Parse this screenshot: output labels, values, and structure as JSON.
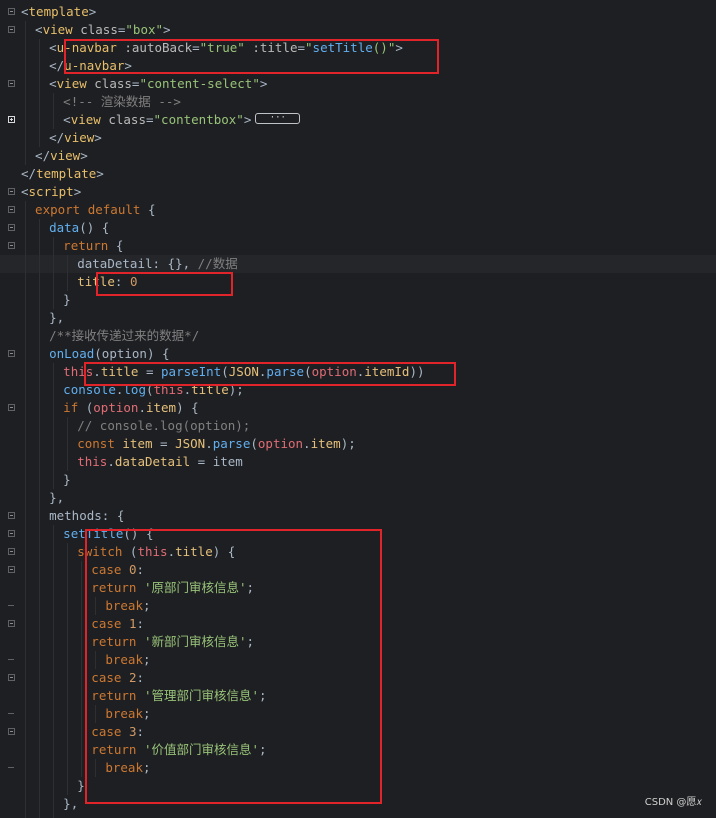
{
  "lines": [
    {
      "fold": "open",
      "indent": 0,
      "tokens": [
        [
          "t-brk",
          "<"
        ],
        [
          "t-tag",
          "template"
        ],
        [
          "t-brk",
          ">"
        ]
      ]
    },
    {
      "fold": "open",
      "indent": 2,
      "tokens": [
        [
          "t-brk",
          "<"
        ],
        [
          "t-tag",
          "view "
        ],
        [
          "t-attr",
          "class"
        ],
        [
          "t-plain",
          "="
        ],
        [
          "t-str2",
          "\"box\""
        ],
        [
          "t-brk",
          ">"
        ]
      ]
    },
    {
      "fold": "none",
      "indent": 4,
      "tokens": [
        [
          "t-brk",
          "<"
        ],
        [
          "t-tag",
          "u-navbar "
        ],
        [
          "t-attr",
          ":autoBack"
        ],
        [
          "t-plain",
          "="
        ],
        [
          "t-str2",
          "\"true\""
        ],
        [
          "t-plain",
          " "
        ],
        [
          "t-attr",
          ":title"
        ],
        [
          "t-plain",
          "="
        ],
        [
          "t-str2",
          "\""
        ],
        [
          "t-fn",
          "setTitle"
        ],
        [
          "t-str2",
          "()\""
        ],
        [
          "t-brk",
          ">"
        ]
      ]
    },
    {
      "fold": "none",
      "indent": 4,
      "tokens": [
        [
          "t-brk",
          "</"
        ],
        [
          "t-tag",
          "u-navbar"
        ],
        [
          "t-brk",
          ">"
        ]
      ]
    },
    {
      "fold": "open",
      "indent": 4,
      "tokens": [
        [
          "t-brk",
          "<"
        ],
        [
          "t-tag",
          "view "
        ],
        [
          "t-attr",
          "class"
        ],
        [
          "t-plain",
          "="
        ],
        [
          "t-str2",
          "\"content-select\""
        ],
        [
          "t-brk",
          ">"
        ]
      ]
    },
    {
      "fold": "none",
      "indent": 6,
      "tokens": [
        [
          "t-cm",
          "<!-- 渲染数据 -->"
        ]
      ]
    },
    {
      "fold": "plus",
      "indent": 6,
      "tokens": [
        [
          "t-brk",
          "<"
        ],
        [
          "t-tag",
          "view "
        ],
        [
          "t-attr",
          "class"
        ],
        [
          "t-plain",
          "="
        ],
        [
          "t-str2",
          "\"contentbox\""
        ],
        [
          "t-brk",
          ">"
        ]
      ],
      "collapsed": "···"
    },
    {
      "fold": "none",
      "indent": 4,
      "tokens": [
        [
          "t-brk",
          "</"
        ],
        [
          "t-tag",
          "view"
        ],
        [
          "t-brk",
          ">"
        ]
      ]
    },
    {
      "fold": "none",
      "indent": 2,
      "tokens": [
        [
          "t-brk",
          "</"
        ],
        [
          "t-tag",
          "view"
        ],
        [
          "t-brk",
          ">"
        ]
      ]
    },
    {
      "fold": "none",
      "indent": 0,
      "tokens": [
        [
          "t-brk",
          "</"
        ],
        [
          "t-tag",
          "template"
        ],
        [
          "t-brk",
          ">"
        ]
      ]
    },
    {
      "fold": "open",
      "indent": 0,
      "tokens": [
        [
          "t-brk",
          "<"
        ],
        [
          "t-tag",
          "script"
        ],
        [
          "t-brk",
          ">"
        ]
      ]
    },
    {
      "fold": "open",
      "indent": 2,
      "tokens": [
        [
          "t-kw",
          "export default "
        ],
        [
          "t-plain",
          "{"
        ]
      ]
    },
    {
      "fold": "open",
      "indent": 4,
      "tokens": [
        [
          "t-fn",
          "data"
        ],
        [
          "t-plain",
          "() {"
        ]
      ]
    },
    {
      "fold": "open",
      "indent": 6,
      "tokens": [
        [
          "t-kw",
          "return "
        ],
        [
          "t-plain",
          "{"
        ]
      ]
    },
    {
      "fold": "none",
      "indent": 8,
      "hl": true,
      "tokens": [
        [
          "t-plain",
          "dataDetail: {}, "
        ],
        [
          "t-cm",
          "//数据"
        ]
      ]
    },
    {
      "fold": "none",
      "indent": 8,
      "tokens": [
        [
          "t-var",
          "title"
        ],
        [
          "t-plain",
          ": "
        ],
        [
          "t-num",
          "0"
        ]
      ]
    },
    {
      "fold": "none",
      "indent": 6,
      "tokens": [
        [
          "t-plain",
          "}"
        ]
      ]
    },
    {
      "fold": "none",
      "indent": 4,
      "tokens": [
        [
          "t-plain",
          "},"
        ]
      ]
    },
    {
      "fold": "none",
      "indent": 4,
      "tokens": [
        [
          "t-cm",
          "/**接收传递过来的数据*/"
        ]
      ]
    },
    {
      "fold": "open",
      "indent": 4,
      "tokens": [
        [
          "t-fn",
          "onLoad"
        ],
        [
          "t-plain",
          "(option) {"
        ]
      ]
    },
    {
      "fold": "none",
      "indent": 6,
      "tokens": [
        [
          "t-this",
          "this"
        ],
        [
          "t-plain",
          "."
        ],
        [
          "t-var",
          "title"
        ],
        [
          "t-plain",
          " = "
        ],
        [
          "t-fn",
          "parseInt"
        ],
        [
          "t-plain",
          "("
        ],
        [
          "t-var",
          "JSON"
        ],
        [
          "t-plain",
          "."
        ],
        [
          "t-fn",
          "parse"
        ],
        [
          "t-plain",
          "("
        ],
        [
          "t-this",
          "option"
        ],
        [
          "t-plain",
          "."
        ],
        [
          "t-var",
          "itemId"
        ],
        [
          "t-plain",
          "))"
        ]
      ]
    },
    {
      "fold": "none",
      "indent": 6,
      "tokens": [
        [
          "t-fn",
          "console"
        ],
        [
          "t-plain",
          "."
        ],
        [
          "t-fn",
          "log"
        ],
        [
          "t-plain",
          "("
        ],
        [
          "t-this",
          "this"
        ],
        [
          "t-plain",
          "."
        ],
        [
          "t-var",
          "title"
        ],
        [
          "t-plain",
          ");"
        ]
      ]
    },
    {
      "fold": "open",
      "indent": 6,
      "tokens": [
        [
          "t-kw",
          "if "
        ],
        [
          "t-plain",
          "("
        ],
        [
          "t-this",
          "option"
        ],
        [
          "t-plain",
          "."
        ],
        [
          "t-var",
          "item"
        ],
        [
          "t-plain",
          ") {"
        ]
      ]
    },
    {
      "fold": "none",
      "indent": 8,
      "tokens": [
        [
          "t-cm",
          "// console.log(option);"
        ]
      ]
    },
    {
      "fold": "none",
      "indent": 8,
      "tokens": [
        [
          "t-kw",
          "const "
        ],
        [
          "t-var",
          "item"
        ],
        [
          "t-plain",
          " = "
        ],
        [
          "t-var",
          "JSON"
        ],
        [
          "t-plain",
          "."
        ],
        [
          "t-fn",
          "parse"
        ],
        [
          "t-plain",
          "("
        ],
        [
          "t-this",
          "option"
        ],
        [
          "t-plain",
          "."
        ],
        [
          "t-var",
          "item"
        ],
        [
          "t-plain",
          ");"
        ]
      ]
    },
    {
      "fold": "none",
      "indent": 8,
      "tokens": [
        [
          "t-this",
          "this"
        ],
        [
          "t-plain",
          "."
        ],
        [
          "t-var",
          "dataDetail"
        ],
        [
          "t-plain",
          " = item"
        ]
      ]
    },
    {
      "fold": "none",
      "indent": 6,
      "tokens": [
        [
          "t-plain",
          "}"
        ]
      ]
    },
    {
      "fold": "none",
      "indent": 4,
      "tokens": [
        [
          "t-plain",
          "},"
        ]
      ]
    },
    {
      "fold": "open",
      "indent": 4,
      "tokens": [
        [
          "t-plain",
          "methods: {"
        ]
      ]
    },
    {
      "fold": "open",
      "indent": 6,
      "tokens": [
        [
          "t-fn",
          "setTitle"
        ],
        [
          "t-plain",
          "() {"
        ]
      ]
    },
    {
      "fold": "open",
      "indent": 8,
      "tokens": [
        [
          "t-kw",
          "switch "
        ],
        [
          "t-plain",
          "("
        ],
        [
          "t-this",
          "this"
        ],
        [
          "t-plain",
          "."
        ],
        [
          "t-var",
          "title"
        ],
        [
          "t-plain",
          ") {"
        ]
      ]
    },
    {
      "fold": "open",
      "indent": 10,
      "tokens": [
        [
          "t-kw",
          "case "
        ],
        [
          "t-num",
          "0"
        ],
        [
          "t-plain",
          ":"
        ]
      ]
    },
    {
      "fold": "none",
      "indent": 10,
      "tokens": [
        [
          "t-kw",
          "return "
        ],
        [
          "t-str2",
          "'原部门审核信息'"
        ],
        [
          "t-plain",
          ";"
        ]
      ]
    },
    {
      "fold": "end",
      "indent": 12,
      "tokens": [
        [
          "t-kw",
          "break"
        ],
        [
          "t-plain",
          ";"
        ]
      ]
    },
    {
      "fold": "open",
      "indent": 10,
      "tokens": [
        [
          "t-kw",
          "case "
        ],
        [
          "t-num",
          "1"
        ],
        [
          "t-plain",
          ":"
        ]
      ]
    },
    {
      "fold": "none",
      "indent": 10,
      "tokens": [
        [
          "t-kw",
          "return "
        ],
        [
          "t-str2",
          "'新部门审核信息'"
        ],
        [
          "t-plain",
          ";"
        ]
      ]
    },
    {
      "fold": "end",
      "indent": 12,
      "tokens": [
        [
          "t-kw",
          "break"
        ],
        [
          "t-plain",
          ";"
        ]
      ]
    },
    {
      "fold": "open",
      "indent": 10,
      "tokens": [
        [
          "t-kw",
          "case "
        ],
        [
          "t-num",
          "2"
        ],
        [
          "t-plain",
          ":"
        ]
      ]
    },
    {
      "fold": "none",
      "indent": 10,
      "tokens": [
        [
          "t-kw",
          "return "
        ],
        [
          "t-str2",
          "'管理部门审核信息'"
        ],
        [
          "t-plain",
          ";"
        ]
      ]
    },
    {
      "fold": "end",
      "indent": 12,
      "tokens": [
        [
          "t-kw",
          "break"
        ],
        [
          "t-plain",
          ";"
        ]
      ]
    },
    {
      "fold": "open",
      "indent": 10,
      "tokens": [
        [
          "t-kw",
          "case "
        ],
        [
          "t-num",
          "3"
        ],
        [
          "t-plain",
          ":"
        ]
      ]
    },
    {
      "fold": "none",
      "indent": 10,
      "tokens": [
        [
          "t-kw",
          "return "
        ],
        [
          "t-str2",
          "'价值部门审核信息'"
        ],
        [
          "t-plain",
          ";"
        ]
      ]
    },
    {
      "fold": "end",
      "indent": 12,
      "tokens": [
        [
          "t-kw",
          "break"
        ],
        [
          "t-plain",
          ";"
        ]
      ]
    },
    {
      "fold": "none",
      "indent": 8,
      "tokens": [
        [
          "t-plain",
          "}"
        ]
      ]
    },
    {
      "fold": "none",
      "indent": 6,
      "tokens": [
        [
          "t-plain",
          "},"
        ]
      ]
    },
    {
      "fold": "none",
      "indent": 6,
      "tokens": [
        [
          "t-plain",
          "..."
        ]
      ]
    }
  ],
  "watermark": "CSDN @愿𝑥"
}
